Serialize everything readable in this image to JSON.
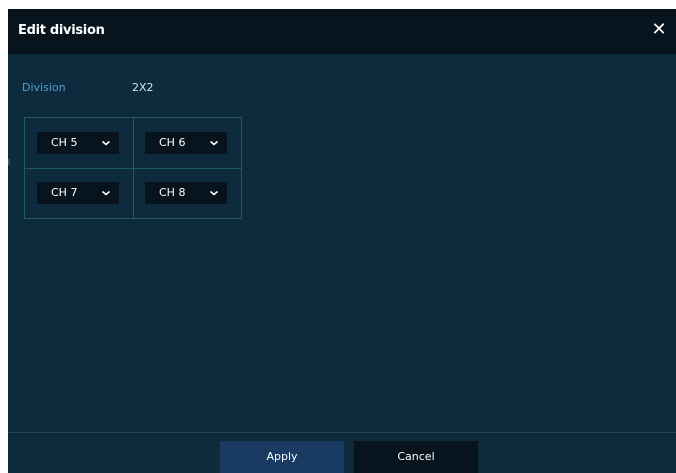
{
  "dialog": {
    "title": "Edit division",
    "close_icon": "close-icon"
  },
  "division": {
    "label": "Division",
    "value": "2X2"
  },
  "channels": [
    {
      "value": "CH 5"
    },
    {
      "value": "CH 6"
    },
    {
      "value": "CH 7"
    },
    {
      "value": "CH 8"
    }
  ],
  "footer": {
    "apply_label": "Apply",
    "cancel_label": "Cancel"
  },
  "colors": {
    "dialog_bg": "#0e2a3d",
    "titlebar_bg": "#07131d",
    "label_accent": "#4e9fd6",
    "grid_border": "#1f5962",
    "apply_bg": "#183a63"
  }
}
